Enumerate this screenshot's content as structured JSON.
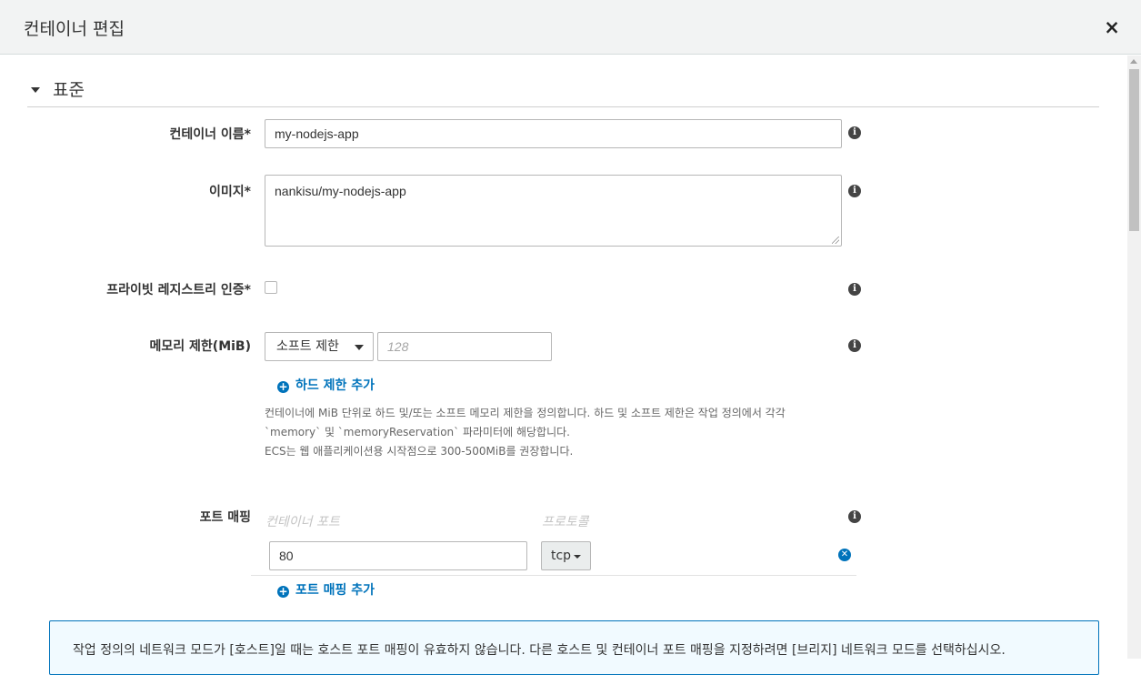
{
  "modal": {
    "title": "컨테이너 편집",
    "close_icon": "×"
  },
  "section": {
    "title": "표준"
  },
  "fields": {
    "container_name": {
      "label": "컨테이너 이름*",
      "value": "my-nodejs-app"
    },
    "image": {
      "label": "이미지*",
      "value": "nankisu/my-nodejs-app"
    },
    "private_registry": {
      "label": "프라이빗 레지스트리 인증*",
      "checked": false
    },
    "memory_limit": {
      "label": "메모리 제한(MiB)",
      "select_value": "소프트 제한",
      "input_placeholder": "128",
      "add_hard_limit": "하드 제한 추가",
      "help_lines": [
        "컨테이너에 MiB 단위로 하드 및/또는 소프트 메모리 제한을 정의합니다. 하드 및 소프트 제한은 작업 정의에서 각각",
        "`memory` 및 `memoryReservation` 파라미터에 해당합니다.",
        "ECS는 웹 애플리케이션용 시작점으로 300-500MiB를 권장합니다."
      ]
    },
    "port_mapping": {
      "label": "포트 매핑",
      "col_container_port": "컨테이너 포트",
      "col_protocol": "프로토콜",
      "rows": [
        {
          "container_port": "80",
          "protocol": "tcp"
        }
      ],
      "add_label": "포트 매핑 추가"
    }
  },
  "alert": {
    "text": "작업 정의의 네트워크 모드가 [호스트]일 때는 호스트 포트 매핑이 유효하지 않습니다. 다른 호스트 및 컨테이너 포트 매핑을 지정하려면 [브리지] 네트워크 모드를 선택하십시오."
  },
  "colors": {
    "link": "#0073bb",
    "header_bg": "#f2f3f3",
    "alert_bg": "#f1faff"
  },
  "icons": {
    "info": "info-icon",
    "add": "plus-circle-icon",
    "remove": "remove-circle-icon",
    "close": "close-icon"
  }
}
